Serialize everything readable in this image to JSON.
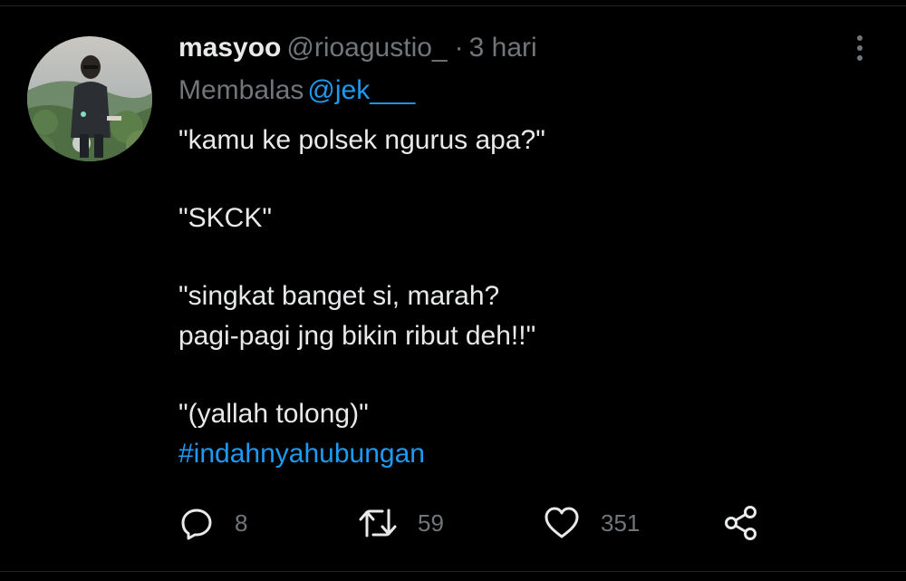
{
  "tweet": {
    "author_name": "masyoo",
    "author_handle": "@rioagustio_",
    "separator": "·",
    "time": "3 hari",
    "reply_prefix": "Membalas",
    "reply_to": "@jek___",
    "lines": {
      "l1": "\"kamu ke polsek ngurus apa?\"",
      "l2": "\"SKCK\"",
      "l3": "\"singkat banget si, marah?",
      "l4": "pagi-pagi jng bikin ribut deh!!\"",
      "l5": "\"(yallah tolong)\""
    },
    "hashtag": "#indahnyahubungan"
  },
  "actions": {
    "reply_count": "8",
    "retweet_count": "59",
    "like_count": "351"
  },
  "icons": {
    "reply": "reply-icon",
    "retweet": "retweet-icon",
    "like": "heart-icon",
    "share": "share-icon",
    "more": "more-vertical-icon"
  },
  "colors": {
    "background": "#000000",
    "text": "#e7e9ea",
    "muted": "#71767b",
    "accent": "#1d9bf0"
  }
}
